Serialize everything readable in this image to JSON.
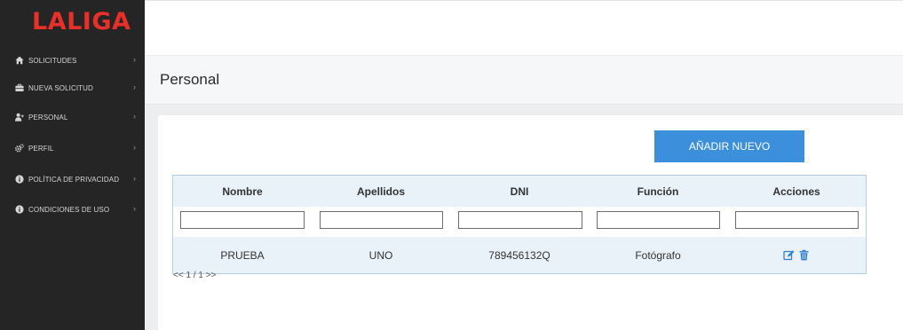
{
  "brand": {
    "logo_text": "LALIGA",
    "logo_color": "#e8302a"
  },
  "sidebar": {
    "items": [
      {
        "label": "SOLICITUDES",
        "icon": "home-icon",
        "chevron": "›"
      },
      {
        "label": "NUEVA SOLICITUD",
        "icon": "briefcase-icon",
        "chevron": "›"
      },
      {
        "label": "PERSONAL",
        "icon": "users-icon",
        "chevron": "›"
      },
      {
        "label": "PERFIL",
        "icon": "gears-icon",
        "chevron": "›"
      },
      {
        "label": "POLÍTICA DE PRIVACIDAD",
        "icon": "info-icon",
        "chevron": "›"
      },
      {
        "label": "CONDICIONES DE USO",
        "icon": "info-icon",
        "chevron": "›"
      }
    ]
  },
  "page": {
    "title": "Personal"
  },
  "toolbar": {
    "add_label": "AÑADIR NUEVO"
  },
  "table": {
    "headers": [
      "Nombre",
      "Apellidos",
      "DNI",
      "Función",
      "Acciones"
    ],
    "filter_values": [
      "",
      "",
      "",
      "",
      ""
    ],
    "rows": [
      {
        "nombre": "PRUEBA",
        "apellidos": "UNO",
        "dni": "789456132Q",
        "funcion": "Fotógrafo",
        "actions": [
          "edit-icon",
          "trash-icon"
        ]
      }
    ]
  },
  "pagination": {
    "text": "<< 1 / 1 >>"
  },
  "colors": {
    "sidebar_bg": "#252525",
    "accent": "#3b8fdb",
    "table_header_bg": "#e9f1f9",
    "table_border": "#b7cfe5",
    "icon_blue": "#2f7fd0"
  }
}
